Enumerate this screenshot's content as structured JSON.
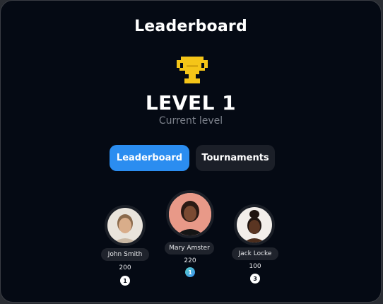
{
  "header": {
    "title": "Leaderboard"
  },
  "level": {
    "label": "LEVEL 1",
    "caption": "Current level"
  },
  "tabs": [
    {
      "label": "Leaderboard",
      "active": true
    },
    {
      "label": "Tournaments",
      "active": false
    }
  ],
  "players": [
    {
      "name": "John Smith",
      "score": "200",
      "rank": "1"
    },
    {
      "name": "Mary Amster",
      "score": "220",
      "rank": "1"
    },
    {
      "name": "Jack Locke",
      "score": "100",
      "rank": "3"
    }
  ],
  "colors": {
    "background": "#050a14",
    "accent": "#2b8df0",
    "trophy": "#f5c518",
    "pill": "#1f232c"
  },
  "icons": {
    "trophy": "trophy-icon"
  }
}
